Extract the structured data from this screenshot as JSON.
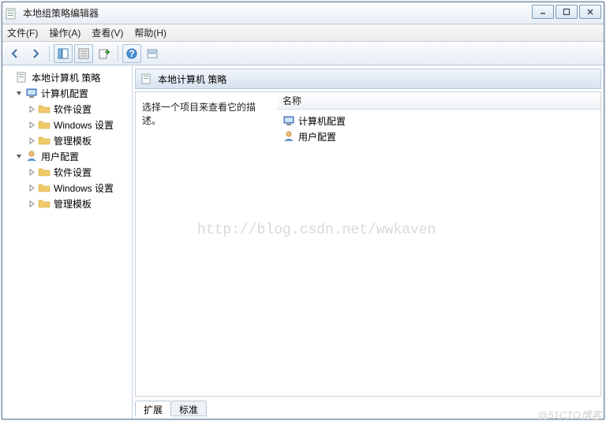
{
  "window": {
    "title": "本地组策略编辑器"
  },
  "menu": {
    "file": "文件(F)",
    "action": "操作(A)",
    "view": "查看(V)",
    "help": "帮助(H)"
  },
  "tree": {
    "root": "本地计算机 策略",
    "computer": {
      "label": "计算机配置",
      "software": "软件设置",
      "windows": "Windows 设置",
      "templates": "管理模板"
    },
    "user": {
      "label": "用户配置",
      "software": "软件设置",
      "windows": "Windows 设置",
      "templates": "管理模板"
    }
  },
  "right": {
    "title": "本地计算机 策略",
    "prompt": "选择一个项目来查看它的描述。",
    "column_name": "名称",
    "items": {
      "computer": "计算机配置",
      "user": "用户配置"
    }
  },
  "tabs": {
    "extended": "扩展",
    "standard": "标准"
  },
  "watermark": "http://blog.csdn.net/wwkaven",
  "corner": "@51CTO博客"
}
